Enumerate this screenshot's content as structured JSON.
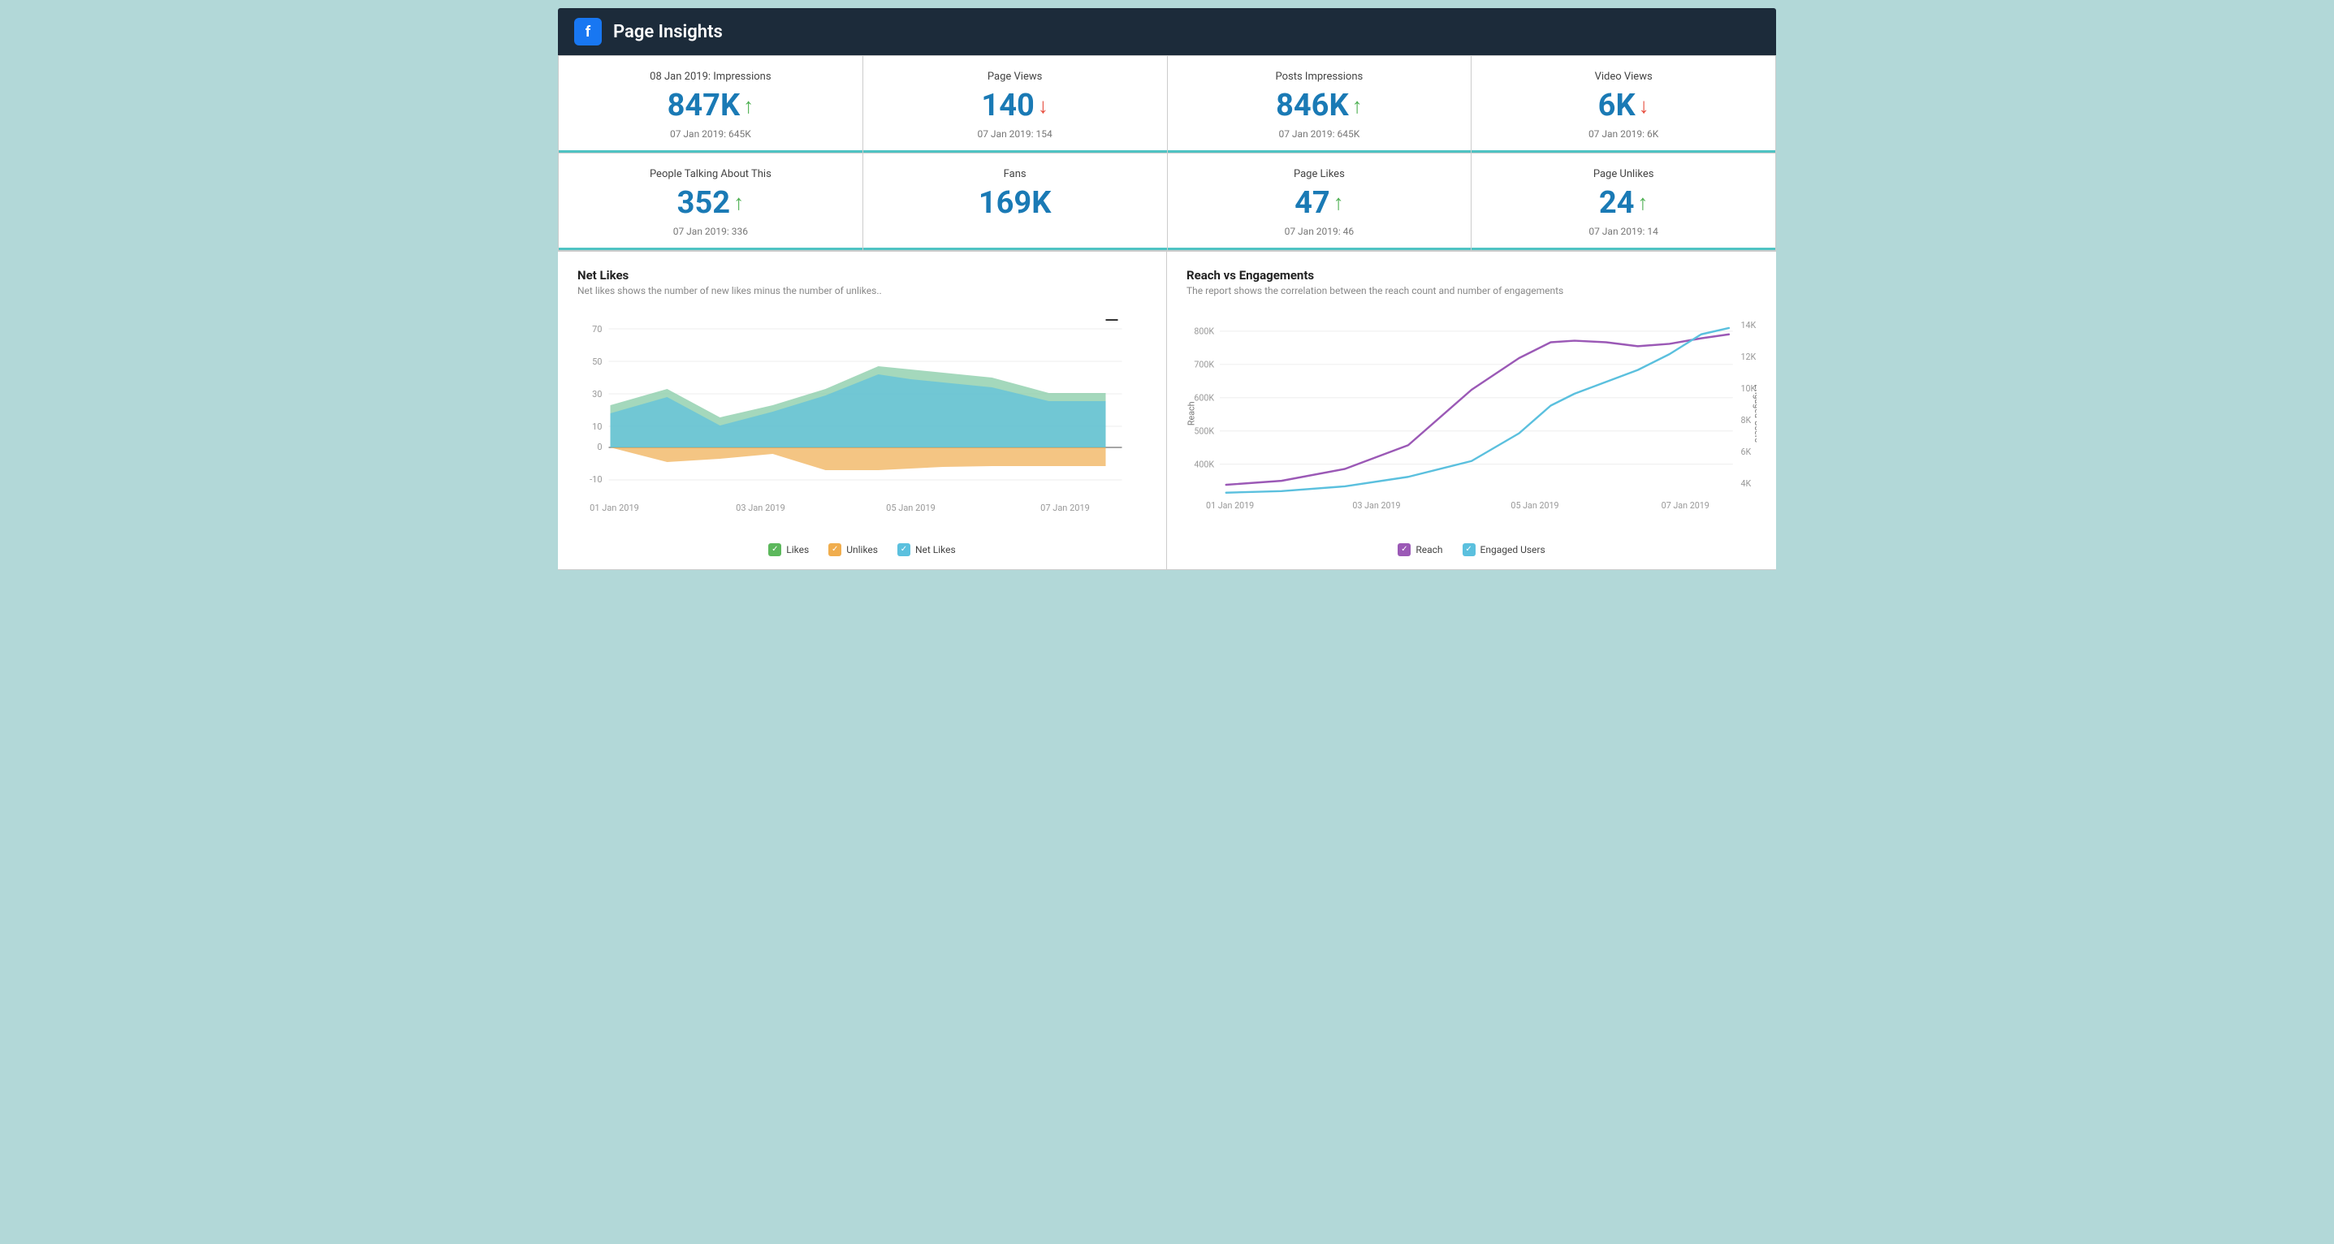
{
  "header": {
    "title": "Page Insights",
    "fb_label": "f"
  },
  "metrics_row1": [
    {
      "label": "08 Jan 2019: Impressions",
      "value": "847K",
      "trend": "up",
      "prev": "07 Jan 2019: 645K"
    },
    {
      "label": "Page Views",
      "value": "140",
      "trend": "down",
      "prev": "07 Jan 2019: 154"
    },
    {
      "label": "Posts Impressions",
      "value": "846K",
      "trend": "up",
      "prev": "07 Jan 2019: 645K"
    },
    {
      "label": "Video Views",
      "value": "6K",
      "trend": "down",
      "prev": "07 Jan 2019: 6K"
    }
  ],
  "metrics_row2": [
    {
      "label": "People Talking About This",
      "value": "352",
      "trend": "up",
      "prev": "07 Jan 2019: 336"
    },
    {
      "label": "Fans",
      "value": "169K",
      "trend": "none",
      "prev": ""
    },
    {
      "label": "Page Likes",
      "value": "47",
      "trend": "up",
      "prev": "07 Jan 2019: 46"
    },
    {
      "label": "Page Unlikes",
      "value": "24",
      "trend": "up",
      "prev": "07 Jan 2019: 14"
    }
  ],
  "net_likes_chart": {
    "title": "Net Likes",
    "subtitle": "Net likes shows the number of new likes minus the number of unlikes..",
    "x_labels": [
      "01 Jan 2019",
      "03 Jan 2019",
      "05 Jan 2019",
      "07 Jan 2019"
    ],
    "y_labels": [
      "70",
      "50",
      "30",
      "10",
      "0",
      "-10"
    ],
    "legend": [
      {
        "label": "Likes",
        "color": "#5cb85c"
      },
      {
        "label": "Unlikes",
        "color": "#f0ad4e"
      },
      {
        "label": "Net Likes",
        "color": "#5bc0de"
      }
    ]
  },
  "reach_chart": {
    "title": "Reach vs Engagements",
    "subtitle": "The report shows the correlation between the reach count and number of engagements",
    "x_labels": [
      "01 Jan 2019",
      "03 Jan 2019",
      "05 Jan 2019",
      "07 Jan 2019"
    ],
    "y_left_labels": [
      "800K",
      "700K",
      "600K",
      "500K",
      "400K"
    ],
    "y_right_labels": [
      "14K",
      "12K",
      "10K",
      "8K",
      "6K",
      "4K"
    ],
    "y_left_label": "Reach",
    "y_right_label": "Engaged Users",
    "legend": [
      {
        "label": "Reach",
        "color": "#9b59b6"
      },
      {
        "label": "Engaged Users",
        "color": "#5bc0de"
      }
    ]
  },
  "colors": {
    "accent": "#4fc3c3",
    "blue": "#1a7ab5",
    "green": "#4caf50",
    "red": "#e74c3c",
    "header_bg": "#1c2b3a"
  }
}
